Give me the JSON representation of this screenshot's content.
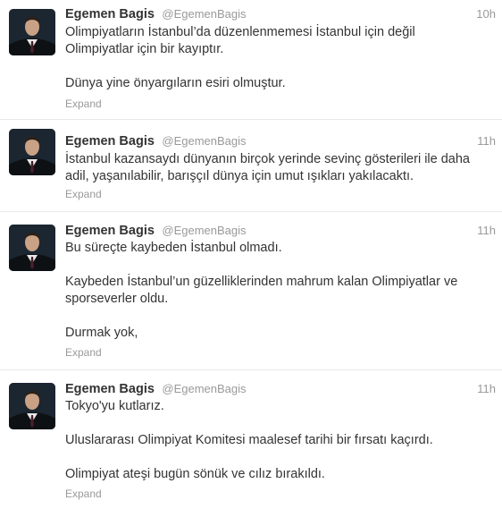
{
  "tweets": [
    {
      "fullname": "Egemen Bagis",
      "username": "@EgemenBagis",
      "time": "10h",
      "lines": [
        "Olimpiyatların İstanbul’da düzenlenmemesi İstanbul için değil",
        "Olimpiyatlar için bir kayıptır.",
        "",
        "Dünya yine önyargıların esiri olmuştur."
      ],
      "expand": "Expand"
    },
    {
      "fullname": "Egemen Bagis",
      "username": "@EgemenBagis",
      "time": "11h",
      "lines": [
        "İstanbul kazansaydı dünyanın birçok yerinde sevinç gösterileri ile daha",
        "adil, yaşanılabilir, barışçıl dünya için umut ışıkları yakılacaktı."
      ],
      "expand": "Expand"
    },
    {
      "fullname": "Egemen Bagis",
      "username": "@EgemenBagis",
      "time": "11h",
      "lines": [
        "Bu süreçte kaybeden İstanbul olmadı.",
        "",
        "Kaybeden İstanbul’un güzelliklerinden mahrum kalan Olimpiyatlar ve",
        "sporseverler oldu.",
        "",
        "Durmak yok,"
      ],
      "expand": "Expand"
    },
    {
      "fullname": "Egemen Bagis",
      "username": "@EgemenBagis",
      "time": "11h",
      "lines": [
        "Tokyo'yu kutlarız.",
        "",
        "Uluslararası Olimpiyat Komitesi maalesef tarihi bir fırsatı kaçırdı.",
        "",
        "Olimpiyat ateşi bugün sönük ve cılız bırakıldı."
      ],
      "expand": "Expand"
    }
  ]
}
